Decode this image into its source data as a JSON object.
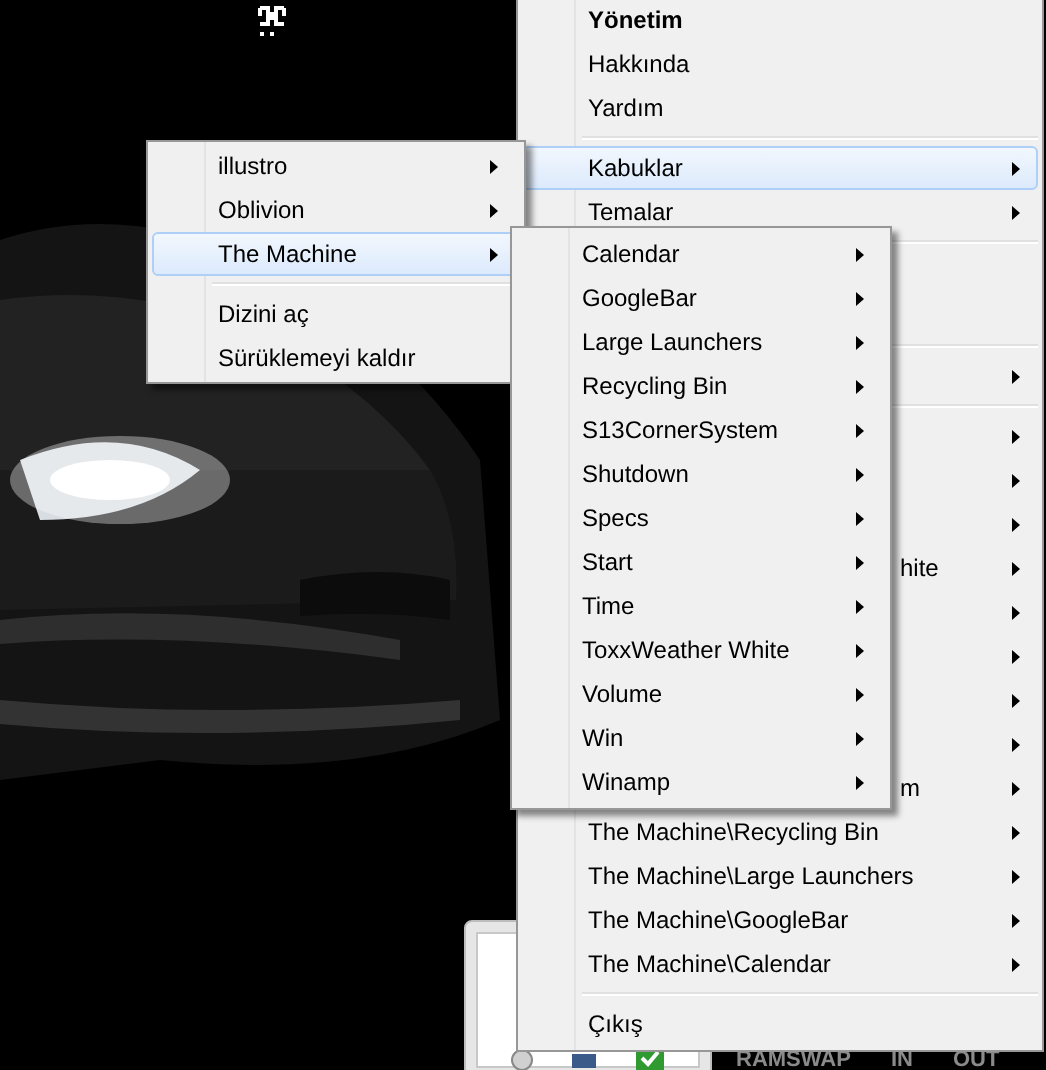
{
  "main_menu": {
    "items": [
      {
        "kind": "item",
        "label": "Yönetim",
        "bold": true,
        "submenu": false,
        "selected": false
      },
      {
        "kind": "item",
        "label": "Hakkında",
        "bold": false,
        "submenu": false,
        "selected": false
      },
      {
        "kind": "item",
        "label": "Yardım",
        "bold": false,
        "submenu": false,
        "selected": false
      },
      {
        "kind": "separator"
      },
      {
        "kind": "item",
        "label": "Kabuklar",
        "bold": false,
        "submenu": true,
        "selected": true
      },
      {
        "kind": "item",
        "label": "Temalar",
        "bold": false,
        "submenu": true,
        "selected": false
      },
      {
        "kind": "separator"
      },
      {
        "kind": "hidden",
        "submenu": false
      },
      {
        "kind": "hidden",
        "submenu": false
      },
      {
        "kind": "separator"
      },
      {
        "kind": "hidden",
        "submenu": true
      },
      {
        "kind": "separator"
      },
      {
        "kind": "hidden",
        "submenu": true
      },
      {
        "kind": "hidden",
        "submenu": true
      },
      {
        "kind": "hidden",
        "submenu": true
      },
      {
        "kind": "partial",
        "label": "hite",
        "submenu": true
      },
      {
        "kind": "hidden",
        "submenu": true
      },
      {
        "kind": "hidden",
        "submenu": true
      },
      {
        "kind": "hidden",
        "submenu": true
      },
      {
        "kind": "hidden",
        "submenu": true
      },
      {
        "kind": "partial",
        "label": "m",
        "submenu": true
      },
      {
        "kind": "item",
        "label": "The Machine\\Recycling Bin",
        "bold": false,
        "submenu": true,
        "selected": false
      },
      {
        "kind": "item",
        "label": "The Machine\\Large Launchers",
        "bold": false,
        "submenu": true,
        "selected": false
      },
      {
        "kind": "item",
        "label": "The Machine\\GoogleBar",
        "bold": false,
        "submenu": true,
        "selected": false
      },
      {
        "kind": "item",
        "label": "The Machine\\Calendar",
        "bold": false,
        "submenu": true,
        "selected": false
      },
      {
        "kind": "separator"
      },
      {
        "kind": "item",
        "label": "Çıkış",
        "bold": false,
        "submenu": false,
        "selected": false
      }
    ]
  },
  "folder_menu": {
    "items": [
      {
        "kind": "item",
        "label": "illustro",
        "submenu": true,
        "selected": false
      },
      {
        "kind": "item",
        "label": "Oblivion",
        "submenu": true,
        "selected": false
      },
      {
        "kind": "item",
        "label": "The Machine",
        "submenu": true,
        "selected": true
      },
      {
        "kind": "separator"
      },
      {
        "kind": "item",
        "label": "Dizini aç",
        "submenu": false,
        "selected": false
      },
      {
        "kind": "item",
        "label": "Sürüklemeyi kaldır",
        "submenu": false,
        "selected": false
      }
    ]
  },
  "skin_menu": {
    "items": [
      {
        "kind": "item",
        "label": "Calendar",
        "submenu": true,
        "selected": false
      },
      {
        "kind": "item",
        "label": "GoogleBar",
        "submenu": true,
        "selected": false
      },
      {
        "kind": "item",
        "label": "Large Launchers",
        "submenu": true,
        "selected": false
      },
      {
        "kind": "item",
        "label": "Recycling Bin",
        "submenu": true,
        "selected": false
      },
      {
        "kind": "item",
        "label": "S13CornerSystem",
        "submenu": true,
        "selected": false
      },
      {
        "kind": "item",
        "label": "Shutdown",
        "submenu": true,
        "selected": false
      },
      {
        "kind": "item",
        "label": "Specs",
        "submenu": true,
        "selected": false
      },
      {
        "kind": "item",
        "label": "Start",
        "submenu": true,
        "selected": false
      },
      {
        "kind": "item",
        "label": "Time",
        "submenu": true,
        "selected": false
      },
      {
        "kind": "item",
        "label": "ToxxWeather White",
        "submenu": true,
        "selected": false
      },
      {
        "kind": "item",
        "label": "Volume",
        "submenu": true,
        "selected": false
      },
      {
        "kind": "item",
        "label": "Win",
        "submenu": true,
        "selected": false
      },
      {
        "kind": "item",
        "label": "Winamp",
        "submenu": true,
        "selected": false
      }
    ]
  },
  "ram_widget": {
    "labels": [
      "RAMSWAP",
      "IN",
      "OUT"
    ]
  }
}
